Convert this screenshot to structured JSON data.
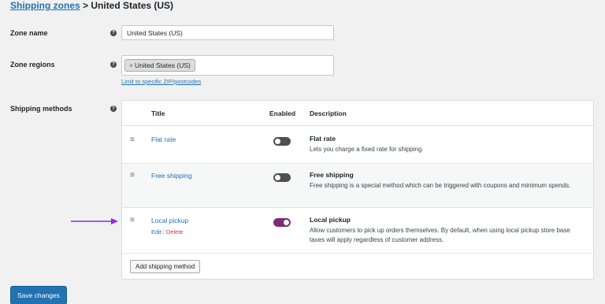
{
  "breadcrumb": {
    "link": "Shipping zones",
    "separator": " > ",
    "current": "United States (US)"
  },
  "zone_name": {
    "label": "Zone name",
    "value": "United States (US)"
  },
  "zone_regions": {
    "label": "Zone regions",
    "chip_remove": "×",
    "chip": "United States (US)",
    "link": "Limit to specific ZIP/postcodes"
  },
  "shipping_methods": {
    "label": "Shipping methods",
    "headers": {
      "title": "Title",
      "enabled": "Enabled",
      "description": "Description"
    },
    "rows": [
      {
        "title": "Flat rate",
        "enabled": false,
        "desc_title": "Flat rate",
        "desc": "Lets you charge a fixed rate for shipping."
      },
      {
        "title": "Free shipping",
        "enabled": false,
        "desc_title": "Free shipping",
        "desc": "Free shipping is a special method which can be triggered with coupons and minimum spends."
      },
      {
        "title": "Local pickup",
        "enabled": true,
        "desc_title": "Local pickup",
        "desc": "Allow customers to pick up orders themselves. By default, when using local pickup store base taxes will apply regardless of customer address.",
        "edit": "Edit",
        "sep": "|",
        "delete": "Delete"
      }
    ],
    "add_button": "Add shipping method"
  },
  "save_button": "Save changes",
  "drag_icon": "≡",
  "help_icon": "?",
  "colors": {
    "link": "#2271b1",
    "primary": "#2271b1",
    "toggle_on": "#7d2c7c",
    "arrow": "#8a2be2",
    "delete": "#d63638"
  }
}
